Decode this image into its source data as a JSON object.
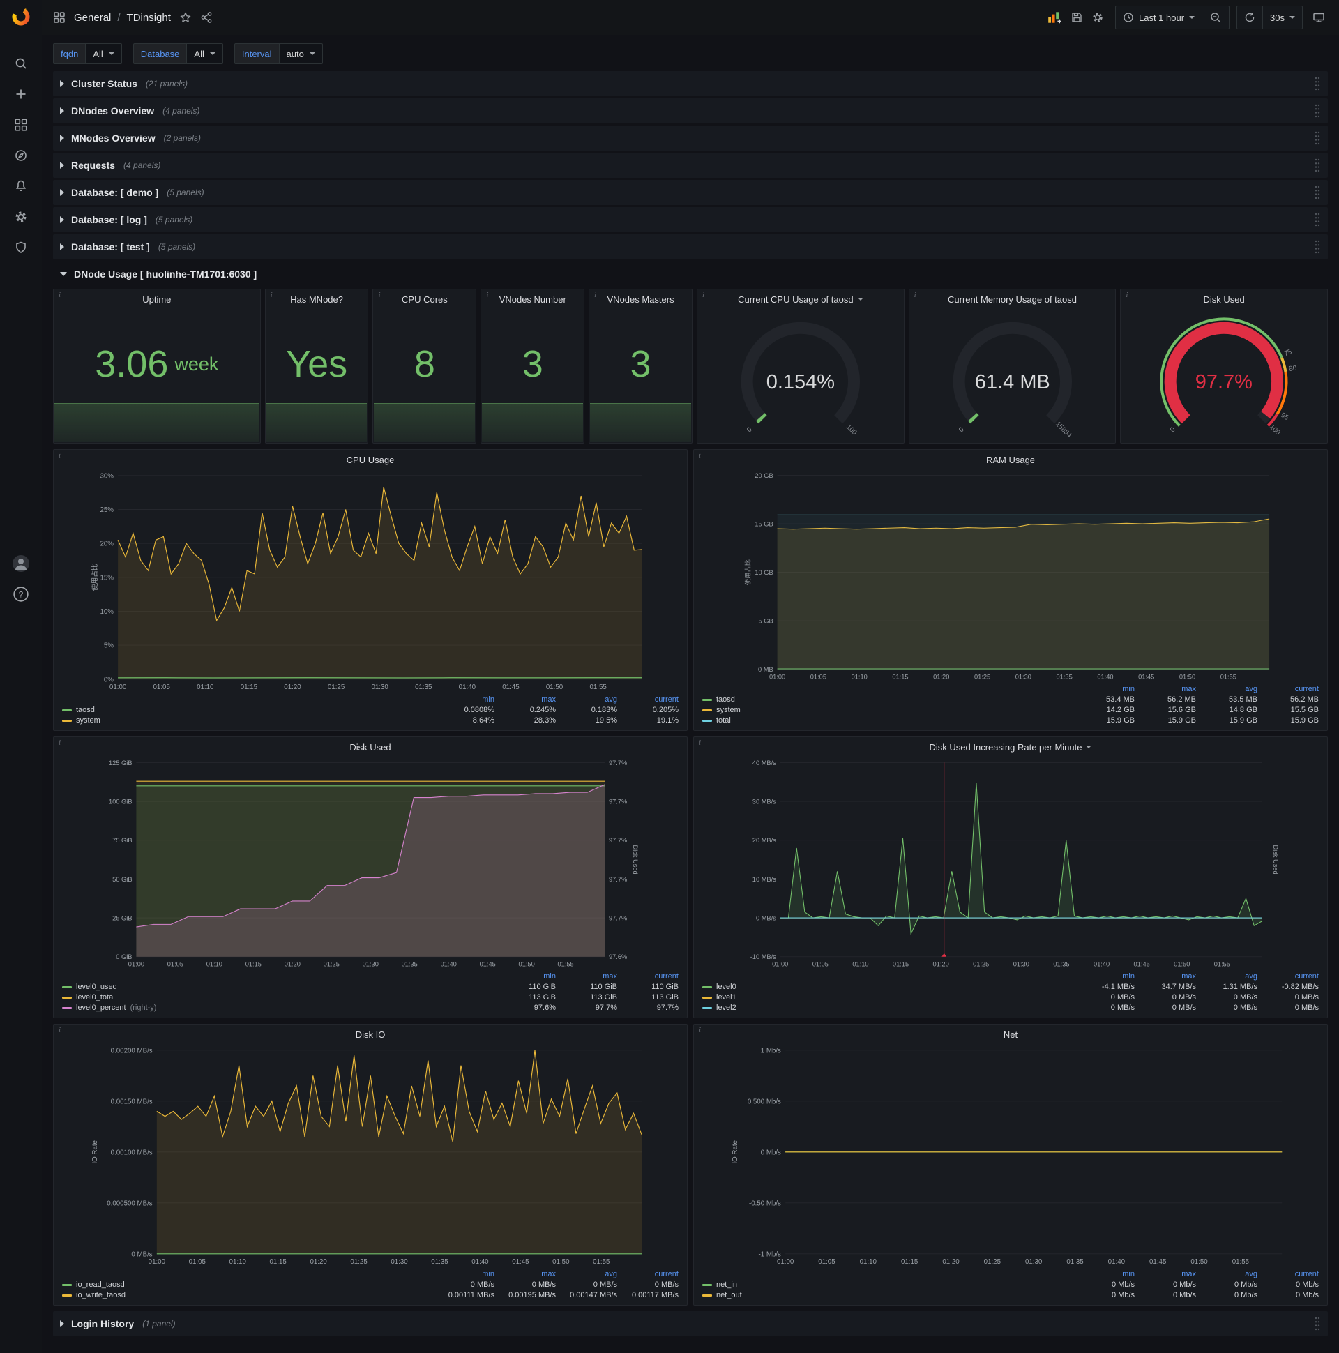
{
  "colors": {
    "green": "#73bf69",
    "yellow": "#eab839",
    "light_blue": "#6ed0e0",
    "blue": "#5794f2",
    "red": "#e02f44",
    "pink": "#d683ce",
    "orange": "#f05a28"
  },
  "sidebar": {
    "icons": [
      "grafana-logo",
      "search",
      "add",
      "dashboards",
      "explore",
      "alerting",
      "configuration",
      "server-admin"
    ],
    "bottom_icons": [
      "user-avatar",
      "help"
    ]
  },
  "nav": {
    "breadcrumb": {
      "section": "General",
      "separator": "/",
      "page": "TDinsight"
    },
    "time_range_label": "Last 1 hour",
    "refresh_value": "30s"
  },
  "variables": [
    {
      "label": "fqdn",
      "value": "All"
    },
    {
      "label": "Database",
      "value": "All"
    },
    {
      "label": "Interval",
      "value": "auto"
    }
  ],
  "rows": [
    {
      "title": "Cluster Status",
      "count": "(21 panels)"
    },
    {
      "title": "DNodes Overview",
      "count": "(4 panels)"
    },
    {
      "title": "MNodes Overview",
      "count": "(2 panels)"
    },
    {
      "title": "Requests",
      "count": "(4 panels)"
    },
    {
      "title": "Database: [ demo ]",
      "count": "(5 panels)"
    },
    {
      "title": "Database: [ log ]",
      "count": "(5 panels)"
    },
    {
      "title": "Database: [ test ]",
      "count": "(5 panels)"
    }
  ],
  "expanded_row_title": "DNode Usage [ huolinhe-TM1701:6030 ]",
  "footer_row": {
    "title": "Login History",
    "count": "(1 panel)"
  },
  "stats": [
    {
      "title": "Uptime",
      "value": "3.06",
      "suffix": "week"
    },
    {
      "title": "Has MNode?",
      "value": "Yes",
      "suffix": ""
    },
    {
      "title": "CPU Cores",
      "value": "8",
      "suffix": ""
    },
    {
      "title": "VNodes Number",
      "value": "3",
      "suffix": ""
    },
    {
      "title": "VNodes Masters",
      "value": "3",
      "suffix": ""
    }
  ],
  "gauges": [
    {
      "title": "Current CPU Usage of taosd",
      "value": "0.154%",
      "fraction": 0.00154,
      "arc_color": "#73bf69",
      "value_color": "#d8d9da",
      "ticks": [
        {
          "label": "0",
          "frac": 0
        },
        {
          "label": "100",
          "frac": 1
        }
      ]
    },
    {
      "title": "Current Memory Usage of taosd",
      "value": "61.4 MB",
      "fraction": 0.0039,
      "arc_color": "#73bf69",
      "value_color": "#d8d9da",
      "ticks": [
        {
          "label": "0",
          "frac": 0
        },
        {
          "label": "15854",
          "frac": 1
        }
      ]
    },
    {
      "title": "Disk Used",
      "value": "97.7%",
      "fraction": 0.977,
      "arc_color": "#e02f44",
      "value_color": "#e02f44",
      "ticks": [
        {
          "label": "0",
          "frac": 0
        },
        {
          "label": "75",
          "frac": 0.75
        },
        {
          "label": "80",
          "frac": 0.8
        },
        {
          "label": "95",
          "frac": 0.95
        },
        {
          "label": "100",
          "frac": 1
        }
      ],
      "ring": [
        {
          "from": 0,
          "to": 0.75,
          "color": "#73bf69"
        },
        {
          "from": 0.75,
          "to": 0.8,
          "color": "#eab839"
        },
        {
          "from": 0.8,
          "to": 0.95,
          "color": "#ff780a"
        },
        {
          "from": 0.95,
          "to": 1,
          "color": "#e02f44"
        }
      ]
    }
  ],
  "chart_data": [
    {
      "type": "line",
      "title": "CPU Usage",
      "ylabel": "使用占比",
      "y_min": 0,
      "y_max": 30,
      "y_tick_labels": [
        "30%",
        "25%",
        "20%",
        "15%",
        "10%",
        "5%",
        "0%"
      ],
      "x_tick_labels": [
        "01:00",
        "01:05",
        "01:10",
        "01:15",
        "01:20",
        "01:25",
        "01:30",
        "01:35",
        "01:40",
        "01:45",
        "01:50",
        "01:55"
      ],
      "series": [
        {
          "name": "system",
          "color": "#eab839",
          "fill_opacity": 0.12,
          "points": [
            20.5,
            18,
            21.5,
            17.5,
            16,
            20.5,
            21,
            15.5,
            17,
            20,
            18.5,
            17.5,
            14,
            8.64,
            10.5,
            13.5,
            10,
            16,
            15.5,
            24.5,
            19,
            16.5,
            18,
            25.5,
            21,
            17,
            20,
            24.5,
            18.5,
            21,
            25,
            19,
            18,
            21.5,
            18.5,
            28.3,
            24,
            20,
            18.5,
            17.5,
            23,
            19.5,
            27.5,
            22,
            18,
            16,
            19.5,
            22.5,
            17,
            21,
            18.5,
            23.5,
            18,
            15.5,
            17,
            21,
            19.5,
            16.5,
            18,
            23,
            20.5,
            27,
            21,
            26,
            19.5,
            23,
            21.5,
            24,
            19,
            19.1
          ]
        },
        {
          "name": "taosd",
          "color": "#73bf69",
          "fill_opacity": 0.15,
          "points": [
            0.2,
            0.21,
            0.19,
            0.2,
            0.22,
            0.2,
            0.19,
            0.21,
            0.2,
            0.2,
            0.21,
            0.205
          ]
        }
      ],
      "legend": {
        "headers": [
          "min",
          "max",
          "avg",
          "current"
        ],
        "rows": [
          {
            "name": "taosd",
            "color": "#73bf69",
            "values": [
              "0.0808%",
              "0.245%",
              "0.183%",
              "0.205%"
            ]
          },
          {
            "name": "system",
            "color": "#eab839",
            "values": [
              "8.64%",
              "28.3%",
              "19.5%",
              "19.1%"
            ]
          }
        ]
      }
    },
    {
      "type": "line",
      "title": "RAM Usage",
      "ylabel": "使用占比",
      "y_min": 0,
      "y_max": 20,
      "y_tick_labels": [
        "20 GB",
        "15 GB",
        "10 GB",
        "5 GB",
        "0 MB"
      ],
      "x_tick_labels": [
        "01:00",
        "01:05",
        "01:10",
        "01:15",
        "01:20",
        "01:25",
        "01:30",
        "01:35",
        "01:40",
        "01:45",
        "01:50",
        "01:55"
      ],
      "series": [
        {
          "name": "system",
          "color": "#eab839",
          "fill_opacity": 0.13,
          "points": [
            14.5,
            14.45,
            14.5,
            14.55,
            14.5,
            14.45,
            14.5,
            14.55,
            14.6,
            14.5,
            14.55,
            14.5,
            14.6,
            14.55,
            14.6,
            14.65,
            14.95,
            14.9,
            14.95,
            15.0,
            14.95,
            15.0,
            15.05,
            15.0,
            15.05,
            15.1,
            15.05,
            15.1,
            15.15,
            15.1,
            15.2,
            15.5
          ]
        },
        {
          "name": "taosd",
          "color": "#73bf69",
          "fill_opacity": 0.15,
          "points": [
            0.056,
            0.055,
            0.056,
            0.056,
            0.055,
            0.056,
            0.056,
            0.055,
            0.056,
            0.056,
            0.055,
            0.056
          ]
        },
        {
          "name": "total",
          "color": "#6ed0e0",
          "fill_opacity": 0.06,
          "points": [
            15.9,
            15.9,
            15.9,
            15.9,
            15.9,
            15.9,
            15.9,
            15.9,
            15.9,
            15.9,
            15.9,
            15.9
          ]
        }
      ],
      "legend": {
        "headers": [
          "min",
          "max",
          "avg",
          "current"
        ],
        "rows": [
          {
            "name": "taosd",
            "color": "#73bf69",
            "values": [
              "53.4 MB",
              "56.2 MB",
              "53.5 MB",
              "56.2 MB"
            ]
          },
          {
            "name": "system",
            "color": "#eab839",
            "values": [
              "14.2 GB",
              "15.6 GB",
              "14.8 GB",
              "15.5 GB"
            ]
          },
          {
            "name": "total",
            "color": "#6ed0e0",
            "values": [
              "15.9 GB",
              "15.9 GB",
              "15.9 GB",
              "15.9 GB"
            ]
          }
        ]
      }
    },
    {
      "type": "line",
      "title": "Disk Used",
      "y_min": 0,
      "y_max": 125,
      "y_tick_labels": [
        "125 GiB",
        "100 GiB",
        "75 GiB",
        "50 GiB",
        "25 GiB",
        "0 GiB"
      ],
      "y2_min": 97.575,
      "y2_max": 97.725,
      "y2_label": "Disk Used",
      "y2_tick_labels": [
        "97.7%",
        "97.7%",
        "97.7%",
        "97.7%",
        "97.7%",
        "97.6%"
      ],
      "x_tick_labels": [
        "01:00",
        "01:05",
        "01:10",
        "01:15",
        "01:20",
        "01:25",
        "01:30",
        "01:35",
        "01:40",
        "01:45",
        "01:50",
        "01:55"
      ],
      "series": [
        {
          "name": "level0_total",
          "color": "#eab839",
          "fill_opacity": 0.09,
          "points": [
            113,
            113,
            113,
            113,
            113,
            113,
            113,
            113,
            113,
            113,
            113,
            113
          ]
        },
        {
          "name": "level0_used",
          "color": "#73bf69",
          "fill_opacity": 0.12,
          "points": [
            110,
            110,
            110,
            110,
            110,
            110,
            110,
            110,
            110,
            110,
            110,
            110
          ]
        },
        {
          "name": "level0_percent",
          "color": "#d683ce",
          "axis": "right",
          "fill_opacity": 0.18,
          "points": [
            97.598,
            97.6,
            97.6,
            97.606,
            97.606,
            97.606,
            97.612,
            97.612,
            97.612,
            97.618,
            97.618,
            97.63,
            97.63,
            97.636,
            97.636,
            97.64,
            97.698,
            97.698,
            97.699,
            97.699,
            97.7,
            97.7,
            97.7,
            97.701,
            97.701,
            97.702,
            97.702,
            97.708
          ]
        }
      ],
      "legend": {
        "headers": [
          "min",
          "max",
          "current"
        ],
        "rows": [
          {
            "name": "level0_used",
            "color": "#73bf69",
            "values": [
              "110 GiB",
              "110 GiB",
              "110 GiB"
            ]
          },
          {
            "name": "level0_total",
            "color": "#eab839",
            "values": [
              "113 GiB",
              "113 GiB",
              "113 GiB"
            ]
          },
          {
            "name": "level0_percent",
            "suffix": "(right-y)",
            "color": "#d683ce",
            "values": [
              "97.6%",
              "97.7%",
              "97.7%"
            ]
          }
        ]
      }
    },
    {
      "type": "line",
      "title": "Disk Used Increasing Rate per Minute",
      "y_min": -10,
      "y_max": 40,
      "y_tick_labels": [
        "40 MB/s",
        "30 MB/s",
        "20 MB/s",
        "10 MB/s",
        "0 MB/s",
        "-10 MB/s"
      ],
      "y2_label": "Disk Used",
      "annotation_x": 0.34,
      "x_tick_labels": [
        "01:00",
        "01:05",
        "01:10",
        "01:15",
        "01:20",
        "01:25",
        "01:30",
        "01:35",
        "01:40",
        "01:45",
        "01:50",
        "01:55"
      ],
      "series": [
        {
          "name": "level0",
          "color": "#73bf69",
          "fill_opacity": 0.14,
          "points": [
            0,
            0,
            18,
            1.5,
            0,
            0.3,
            0,
            12,
            1,
            0.3,
            0,
            0,
            -2,
            0.5,
            0,
            20.5,
            -4.1,
            0.5,
            0,
            0.3,
            0,
            12,
            1.5,
            0,
            34.7,
            1.5,
            0,
            0.3,
            0,
            -0.5,
            0.5,
            0,
            0.3,
            0,
            0.5,
            20,
            0.5,
            0,
            0.3,
            0,
            0.5,
            0,
            0.3,
            0,
            0.5,
            0,
            0.3,
            0,
            0.5,
            0,
            -0.5,
            0.3,
            0,
            0.5,
            0,
            0.3,
            0,
            5,
            -2,
            -0.82
          ]
        },
        {
          "name": "level1",
          "color": "#eab839",
          "fill_opacity": 0,
          "points": [
            0,
            0,
            0,
            0,
            0,
            0,
            0,
            0,
            0,
            0,
            0,
            0
          ]
        },
        {
          "name": "level2",
          "color": "#6ed0e0",
          "fill_opacity": 0,
          "points": [
            0,
            0,
            0,
            0,
            0,
            0,
            0,
            0,
            0,
            0,
            0,
            0
          ]
        }
      ],
      "legend": {
        "headers": [
          "min",
          "max",
          "avg",
          "current"
        ],
        "rows": [
          {
            "name": "level0",
            "color": "#73bf69",
            "values": [
              "-4.1 MB/s",
              "34.7 MB/s",
              "1.31 MB/s",
              "-0.82 MB/s"
            ]
          },
          {
            "name": "level1",
            "color": "#eab839",
            "values": [
              "0 MB/s",
              "0 MB/s",
              "0 MB/s",
              "0 MB/s"
            ]
          },
          {
            "name": "level2",
            "color": "#6ed0e0",
            "values": [
              "0 MB/s",
              "0 MB/s",
              "0 MB/s",
              "0 MB/s"
            ]
          }
        ]
      }
    },
    {
      "type": "line",
      "title": "Disk IO",
      "ylabel": "IO Rate",
      "y_min": 0,
      "y_max": 0.002,
      "y_tick_labels": [
        "0.00200 MB/s",
        "0.00150 MB/s",
        "0.00100 MB/s",
        "0.000500 MB/s",
        "0 MB/s"
      ],
      "x_tick_labels": [
        "01:00",
        "01:05",
        "01:10",
        "01:15",
        "01:20",
        "01:25",
        "01:30",
        "01:35",
        "01:40",
        "01:45",
        "01:50",
        "01:55"
      ],
      "series": [
        {
          "name": "io_write_taosd",
          "color": "#eab839",
          "fill_opacity": 0.12,
          "points": [
            0.0014,
            0.00135,
            0.0014,
            0.00132,
            0.00138,
            0.00145,
            0.00135,
            0.00155,
            0.00115,
            0.0014,
            0.00185,
            0.00125,
            0.00145,
            0.00135,
            0.0015,
            0.0012,
            0.00148,
            0.00165,
            0.00115,
            0.00175,
            0.00135,
            0.00125,
            0.00185,
            0.0013,
            0.00195,
            0.00125,
            0.00175,
            0.00115,
            0.00155,
            0.00135,
            0.00118,
            0.00165,
            0.00135,
            0.0019,
            0.00125,
            0.00145,
            0.0011,
            0.00185,
            0.0014,
            0.0012,
            0.0016,
            0.00132,
            0.00148,
            0.00125,
            0.0017,
            0.00138,
            0.002,
            0.00128,
            0.00152,
            0.00135,
            0.00172,
            0.00118,
            0.00142,
            0.00165,
            0.00128,
            0.00148,
            0.00158,
            0.00122,
            0.00138,
            0.00117
          ]
        },
        {
          "name": "io_read_taosd",
          "color": "#73bf69",
          "fill_opacity": 0.1,
          "points": [
            0,
            0,
            0,
            0,
            0,
            0,
            0,
            0,
            0,
            0,
            0,
            0
          ]
        }
      ],
      "legend": {
        "headers": [
          "min",
          "max",
          "avg",
          "current"
        ],
        "rows": [
          {
            "name": "io_read_taosd",
            "color": "#73bf69",
            "values": [
              "0 MB/s",
              "0 MB/s",
              "0 MB/s",
              "0 MB/s"
            ]
          },
          {
            "name": "io_write_taosd",
            "color": "#eab839",
            "values": [
              "0.00111 MB/s",
              "0.00195 MB/s",
              "0.00147 MB/s",
              "0.00117 MB/s"
            ]
          }
        ]
      }
    },
    {
      "type": "line",
      "title": "Net",
      "ylabel": "IO Rate",
      "y_min": -1,
      "y_max": 1,
      "y_tick_labels": [
        "1 Mb/s",
        "0.500 Mb/s",
        "0 Mb/s",
        "-0.50 Mb/s",
        "-1 Mb/s"
      ],
      "x_tick_labels": [
        "01:00",
        "01:05",
        "01:10",
        "01:15",
        "01:20",
        "01:25",
        "01:30",
        "01:35",
        "01:40",
        "01:45",
        "01:50",
        "01:55"
      ],
      "series": [
        {
          "name": "net_in",
          "color": "#73bf69",
          "fill_opacity": 0,
          "points": [
            0,
            0,
            0,
            0,
            0,
            0,
            0,
            0,
            0,
            0,
            0,
            0
          ]
        },
        {
          "name": "net_out",
          "color": "#eab839",
          "fill_opacity": 0,
          "points": [
            0,
            0,
            0,
            0,
            0,
            0,
            0,
            0,
            0,
            0,
            0,
            0
          ]
        }
      ],
      "legend": {
        "headers": [
          "min",
          "max",
          "avg",
          "current"
        ],
        "rows": [
          {
            "name": "net_in",
            "color": "#73bf69",
            "values": [
              "0 Mb/s",
              "0 Mb/s",
              "0 Mb/s",
              "0 Mb/s"
            ]
          },
          {
            "name": "net_out",
            "color": "#eab839",
            "values": [
              "0 Mb/s",
              "0 Mb/s",
              "0 Mb/s",
              "0 Mb/s"
            ]
          }
        ]
      }
    }
  ]
}
